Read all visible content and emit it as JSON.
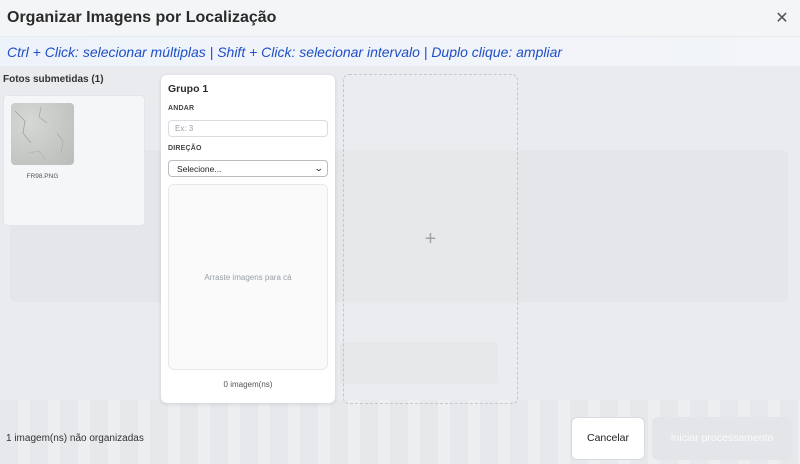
{
  "header": {
    "title": "Organizar Imagens por Localização",
    "close_icon": "close-icon"
  },
  "hint": "Ctrl + Click: selecionar múltiplas | Shift + Click: selecionar intervalo | Duplo clique: ampliar",
  "submitted": {
    "title": "Fotos submetidas (1)",
    "photos": [
      {
        "name": "FR98.PNG"
      }
    ]
  },
  "groups": [
    {
      "title": "Grupo 1",
      "floor_label": "ANDAR",
      "floor_placeholder": "Ex: 3",
      "floor_value": "",
      "direction_label": "DIREÇÃO",
      "direction_selected": "Selecione...",
      "dropzone_text": "Arraste imagens para cá",
      "count_text": "0 imagem(ns)"
    }
  ],
  "add_group_icon": "plus-icon",
  "footer": {
    "status": "1 imagem(ns) não organizadas",
    "cancel_label": "Cancelar",
    "start_label": "Iniciar processamento"
  }
}
